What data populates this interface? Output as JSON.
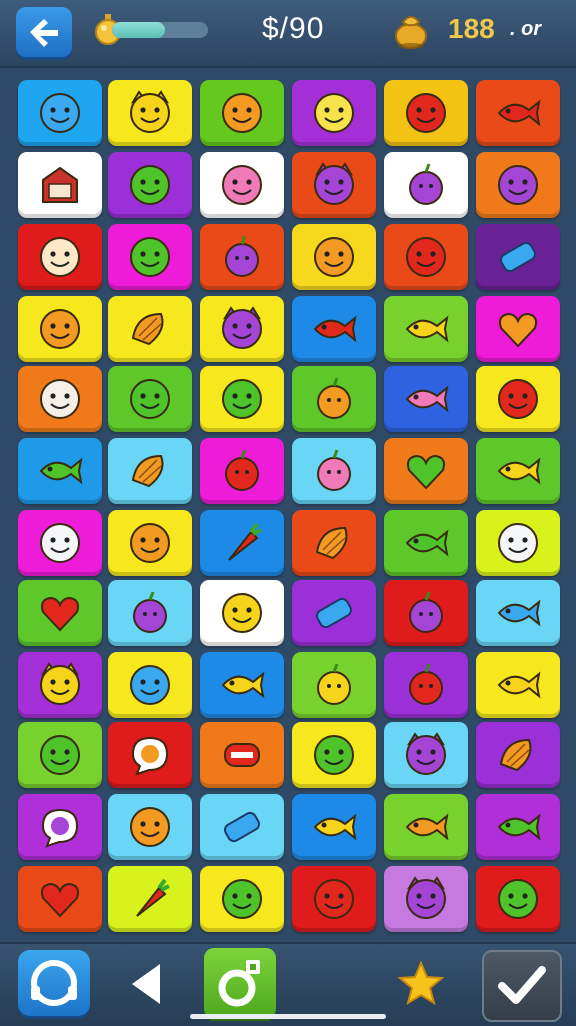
{
  "header": {
    "back_icon": "back-arrow-icon",
    "progress_fraction": 0.55,
    "score_text": "$/90",
    "coin_icon": "gold-bag-icon",
    "coins_value": "188",
    "coins_suffix": ". or"
  },
  "board": {
    "columns": 6,
    "rows": 12,
    "tiles": [
      {
        "bg": "#1ea6f0",
        "icon": "blue-smiley-icon"
      },
      {
        "bg": "#f6e81c",
        "icon": "yellow-cat-face-icon"
      },
      {
        "bg": "#64c81e",
        "icon": "orange-blob-icon"
      },
      {
        "bg": "#a52fd6",
        "icon": "cap-face-icon"
      },
      {
        "bg": "#f2c313",
        "icon": "red-spiky-face-icon"
      },
      {
        "bg": "#ea4a18",
        "icon": "red-fish-icon"
      },
      {
        "bg": "#ffffff",
        "icon": "red-house-icon"
      },
      {
        "bg": "#9b2fd8",
        "icon": "green-face-icon"
      },
      {
        "bg": "#ffffff",
        "icon": "pink-face-icon"
      },
      {
        "bg": "#ea4a18",
        "icon": "purple-cat-icon"
      },
      {
        "bg": "#ffffff",
        "icon": "purple-plum-icon"
      },
      {
        "bg": "#f07a1a",
        "icon": "purple-bean-icon"
      },
      {
        "bg": "#e01b1b",
        "icon": "girl-face-icon"
      },
      {
        "bg": "#ee1bd8",
        "icon": "green-face-icon"
      },
      {
        "bg": "#ea4a18",
        "icon": "purple-berry-icon"
      },
      {
        "bg": "#f6d81c",
        "icon": "orange-face-icon"
      },
      {
        "bg": "#ea4a18",
        "icon": "red-face-icon"
      },
      {
        "bg": "#6a2196",
        "icon": "blue-candy-icon"
      },
      {
        "bg": "#f6e81c",
        "icon": "orange-monkey-icon"
      },
      {
        "bg": "#f6e81c",
        "icon": "orange-shell-icon"
      },
      {
        "bg": "#f6e81c",
        "icon": "purple-cat-icon"
      },
      {
        "bg": "#1e8ae8",
        "icon": "red-heart-fish-icon"
      },
      {
        "bg": "#78d22e",
        "icon": "yellow-fish-icon"
      },
      {
        "bg": "#ee1bd8",
        "icon": "orange-heart-icon"
      },
      {
        "bg": "#f07a1a",
        "icon": "tiki-mask-icon"
      },
      {
        "bg": "#5ec82a",
        "icon": "green-blob-icon"
      },
      {
        "bg": "#f6e81c",
        "icon": "green-smiley-icon"
      },
      {
        "bg": "#5ec82a",
        "icon": "orange-fruit-icon"
      },
      {
        "bg": "#2f62e0",
        "icon": "pink-fish-icon"
      },
      {
        "bg": "#f6e81c",
        "icon": "red-flower-face-icon"
      },
      {
        "bg": "#1e9ae8",
        "icon": "green-fish-icon"
      },
      {
        "bg": "#6ad6f6",
        "icon": "orange-leaf-icon"
      },
      {
        "bg": "#ee1bd8",
        "icon": "red-apple-icon"
      },
      {
        "bg": "#6ad6f6",
        "icon": "pink-radish-icon"
      },
      {
        "bg": "#f07a1a",
        "icon": "green-heart-icon"
      },
      {
        "bg": "#5ec82a",
        "icon": "yellow-fish-icon"
      },
      {
        "bg": "#ee1bd8",
        "icon": "ghost-icon"
      },
      {
        "bg": "#f6e81c",
        "icon": "orange-face-icon"
      },
      {
        "bg": "#1e8ae8",
        "icon": "red-carrot-icon"
      },
      {
        "bg": "#ea4a18",
        "icon": "orange-shrimp-icon"
      },
      {
        "bg": "#5ec82a",
        "icon": "green-fish-icon"
      },
      {
        "bg": "#d8f21c",
        "icon": "white-seal-icon"
      },
      {
        "bg": "#5ec82a",
        "icon": "red-heart-icon"
      },
      {
        "bg": "#6ad6f6",
        "icon": "purple-plum-icon"
      },
      {
        "bg": "#ffffff",
        "icon": "yellow-smiley-icon"
      },
      {
        "bg": "#9b2fd8",
        "icon": "blue-candy-icon"
      },
      {
        "bg": "#e01b1b",
        "icon": "purple-seed-icon"
      },
      {
        "bg": "#6ad6f6",
        "icon": "blue-fish-icon"
      },
      {
        "bg": "#a52fd6",
        "icon": "yellow-cat-icon"
      },
      {
        "bg": "#f6e81c",
        "icon": "blue-smiley-icon"
      },
      {
        "bg": "#1e8ae8",
        "icon": "yellow-banana-fish-icon"
      },
      {
        "bg": "#78d22e",
        "icon": "yellow-pumpkin-icon"
      },
      {
        "bg": "#9b2fd8",
        "icon": "red-apple-icon"
      },
      {
        "bg": "#f6e81c",
        "icon": "yellow-fish-icon"
      },
      {
        "bg": "#78d22e",
        "icon": "green-frog-icon"
      },
      {
        "bg": "#e01b1b",
        "icon": "orange-bubble-icon"
      },
      {
        "bg": "#f07a1a",
        "icon": "red-mouth-icon"
      },
      {
        "bg": "#f6e81c",
        "icon": "green-face-icon"
      },
      {
        "bg": "#6ad6f6",
        "icon": "purple-cat-icon"
      },
      {
        "bg": "#9b2fd8",
        "icon": "orange-shell-icon"
      },
      {
        "bg": "#b02fd8",
        "icon": "purple-bubble-icon"
      },
      {
        "bg": "#6ad6f6",
        "icon": "orange-face-icon"
      },
      {
        "bg": "#6ad6f6",
        "icon": "blue-ticket-icon"
      },
      {
        "bg": "#1e8ae8",
        "icon": "yellow-fish-icon"
      },
      {
        "bg": "#78d22e",
        "icon": "orange-fish-icon"
      },
      {
        "bg": "#b02fd8",
        "icon": "green-fish-icon"
      },
      {
        "bg": "#ea4a18",
        "icon": "red-heart-icon"
      },
      {
        "bg": "#d8f21c",
        "icon": "red-carrot-icon"
      },
      {
        "bg": "#f6e81c",
        "icon": "green-smiley-icon"
      },
      {
        "bg": "#e01b1b",
        "icon": "red-octopus-icon"
      },
      {
        "bg": "#c67ae0",
        "icon": "purple-cat-icon"
      },
      {
        "bg": "#e01b1b",
        "icon": "green-bowl-icon"
      }
    ]
  },
  "footer": {
    "hint_icon": "headset-icon",
    "prev_icon": "play-back-icon",
    "ring_icon": "ring-icon",
    "star_icon": "star-icon",
    "check_icon": "check-icon"
  },
  "colors": {
    "page_bg": "#2f4a66",
    "coin_text": "#f1c94a",
    "accent": "#1f6fc4"
  }
}
